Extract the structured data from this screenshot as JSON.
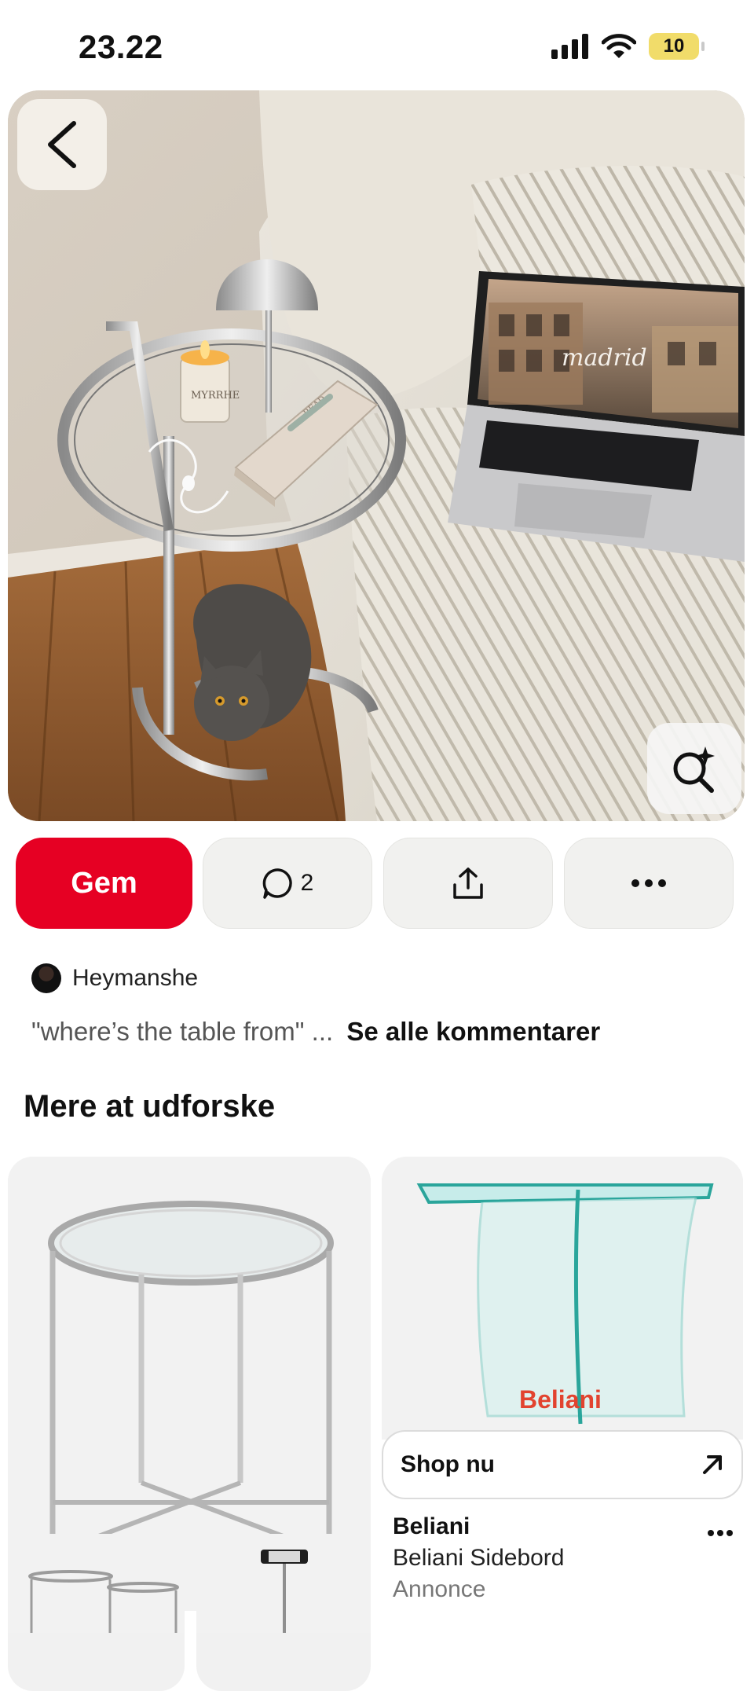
{
  "status_bar": {
    "time": "23.22",
    "battery_level": "10",
    "icons": [
      "cellular-signal-icon",
      "wifi-icon",
      "battery-icon"
    ]
  },
  "pin": {
    "image_overlay_text": "madrid",
    "candle_label": "MYRRHE",
    "book_label": "READ",
    "actions": {
      "save_label": "Gem",
      "comment_count": "2"
    },
    "comment": {
      "author": "Heymanshe",
      "text": "\"where’s the table from\" ...",
      "see_all_label": "Se alle kommentarer"
    }
  },
  "explore": {
    "title": "Mere at udforske",
    "ad_pin": {
      "brand_logo": "Beliani",
      "shop_label": "Shop nu",
      "advertiser": "Beliani",
      "product": "Beliani Sidebord",
      "ad_label": "Annonce"
    }
  },
  "colors": {
    "accent": "#e60023",
    "pill_bg": "#f1f1ef",
    "battery": "#f1dc6a"
  }
}
